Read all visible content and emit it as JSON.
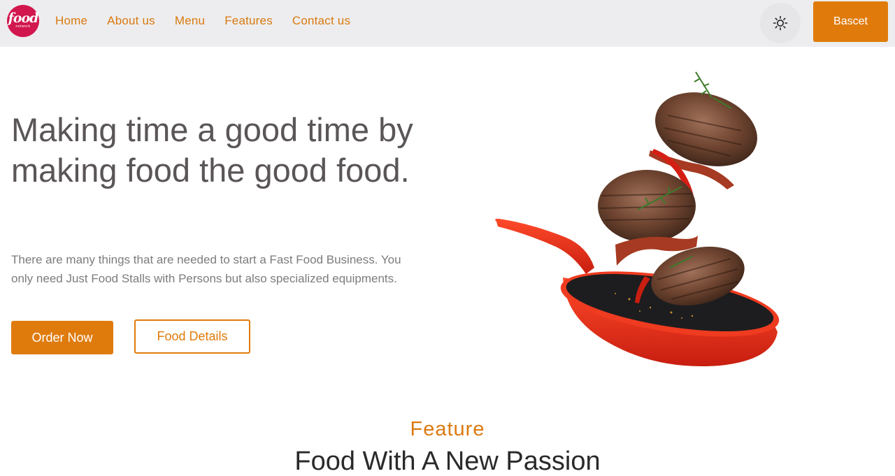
{
  "logo": {
    "word": "food",
    "sub": "network",
    "icon": "food-network-logo"
  },
  "nav": {
    "links": [
      "Home",
      "About us",
      "Menu",
      "Features",
      "Contact us"
    ],
    "theme_icon": "sun-icon",
    "basket_label": "Bascet"
  },
  "hero": {
    "title": "Making time a good time by making food the good food.",
    "text": "There are many things that are needed to start a Fast Food Business. You only need Just Food Stalls with Persons but also specialized equipments.",
    "order_label": "Order Now",
    "details_label": "Food Details",
    "image": "frying-pan-with-flying-steaks"
  },
  "feature": {
    "label": "Feature",
    "title": "Food With A New Passion"
  },
  "colors": {
    "accent": "#e07b0b",
    "logo": "#d1174d",
    "nav_bg": "#ededef",
    "pan": "#e8321b"
  }
}
